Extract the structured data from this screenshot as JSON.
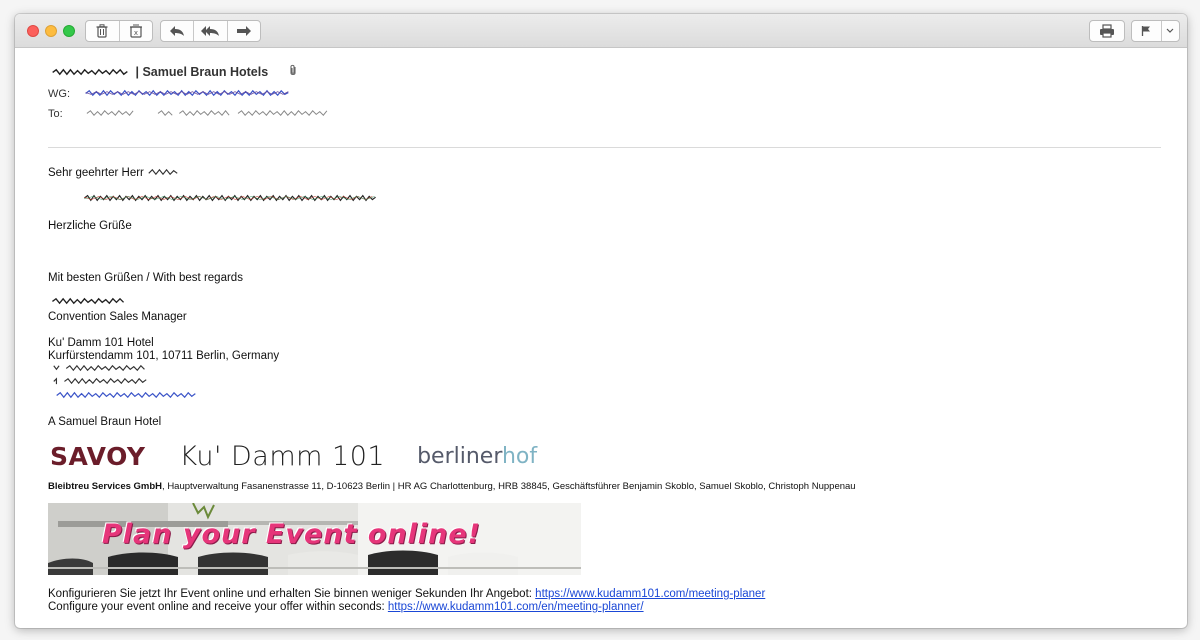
{
  "toolbar": {
    "buttons": [
      "trash-icon",
      "junk-icon",
      "reply-icon",
      "reply-all-icon",
      "forward-icon",
      "print-icon",
      "flag-icon",
      "chevron-down-icon"
    ]
  },
  "header": {
    "subject": "| Samuel Braun Hotels",
    "wg_label": "WG:",
    "to_label": "To:"
  },
  "body": {
    "greeting": "Sehr geehrter Herr",
    "regards": "Herzliche Grüße",
    "signoff": "Mit besten Grüßen / With best regards",
    "title": "Convention Sales Manager",
    "hotel_name": "Ku' Damm 101 Hotel",
    "address": "Kurfürstendamm 101, 10711 Berlin, Germany",
    "brand_line": "A Samuel Braun Hotel"
  },
  "logos": {
    "savoy": "SAVOY",
    "kudamm": "Ku' Damm 101",
    "berliner_part1": "berliner",
    "berliner_part2": "hof"
  },
  "legal": {
    "company": "Bleibtreu Services GmbH",
    "rest": ", Hauptverwaltung Fasanenstrasse 11, D-10623 Berlin | HR AG Charlottenburg, HRB 38845, Geschäftsführer Benjamin Skoblo, Samuel Skoblo, Christoph Nuppenau"
  },
  "banner": {
    "text": "Plan your Event online!"
  },
  "cta": {
    "de_text": "Konfigurieren Sie jetzt Ihr Event online und erhalten Sie binnen weniger Sekunden Ihr Angebot: ",
    "de_link": "https://www.kudamm101.com/meeting-planer",
    "en_text": "Configure your event online and receive your offer within seconds: ",
    "en_link": "https://www.kudamm101.com/en/meeting-planner/"
  },
  "colors": {
    "savoy": "#6b1d2a",
    "banner_text": "#e6357a",
    "link": "#1a47d6"
  }
}
